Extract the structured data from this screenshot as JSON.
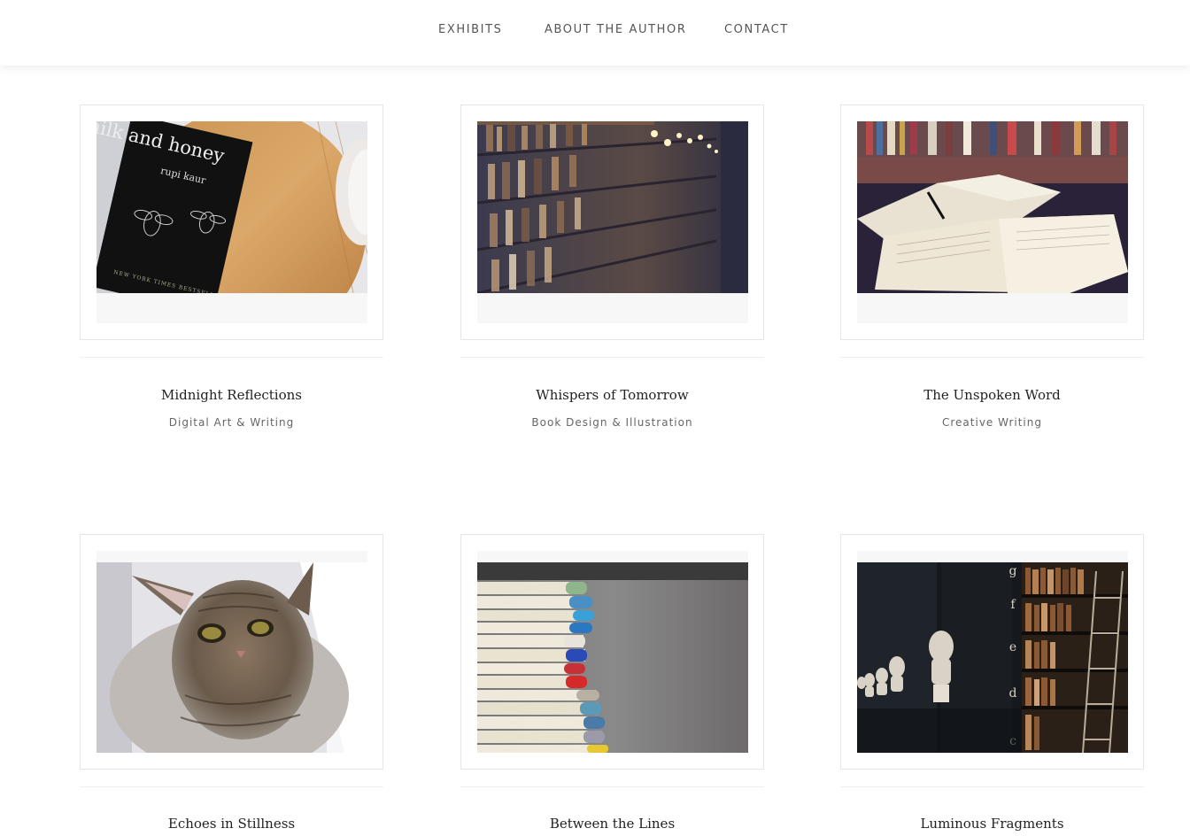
{
  "nav": {
    "items": [
      {
        "label": "EXHIBITS"
      },
      {
        "label": "ABOUT THE AUTHOR"
      },
      {
        "label": "CONTACT"
      }
    ]
  },
  "exhibits": [
    {
      "title": "Midnight Reflections",
      "category": "Digital Art & Writing",
      "image": "book-milk-and-honey-photo",
      "book_title": "milk and honey",
      "book_author": "rupi kaur",
      "book_footer": "NEW YORK TIMES BESTSELLER"
    },
    {
      "title": "Whispers of Tomorrow",
      "category": "Book Design & Illustration",
      "image": "library-shelves-photo"
    },
    {
      "title": "The Unspoken Word",
      "category": "Creative Writing",
      "image": "open-books-photo"
    },
    {
      "title": "Echoes in Stillness",
      "image": "kitten-photo"
    },
    {
      "title": "Between the Lines",
      "image": "book-stack-photo"
    },
    {
      "title": "Luminous Fragments",
      "image": "library-busts-photo",
      "shelf_letters": [
        "g",
        "f",
        "e",
        "d",
        "c"
      ]
    }
  ],
  "colors": {
    "background": "#ffffff",
    "card_border": "#e6e6e6",
    "frame_fill": "#f7f7f7",
    "nav_text": "#555555"
  }
}
